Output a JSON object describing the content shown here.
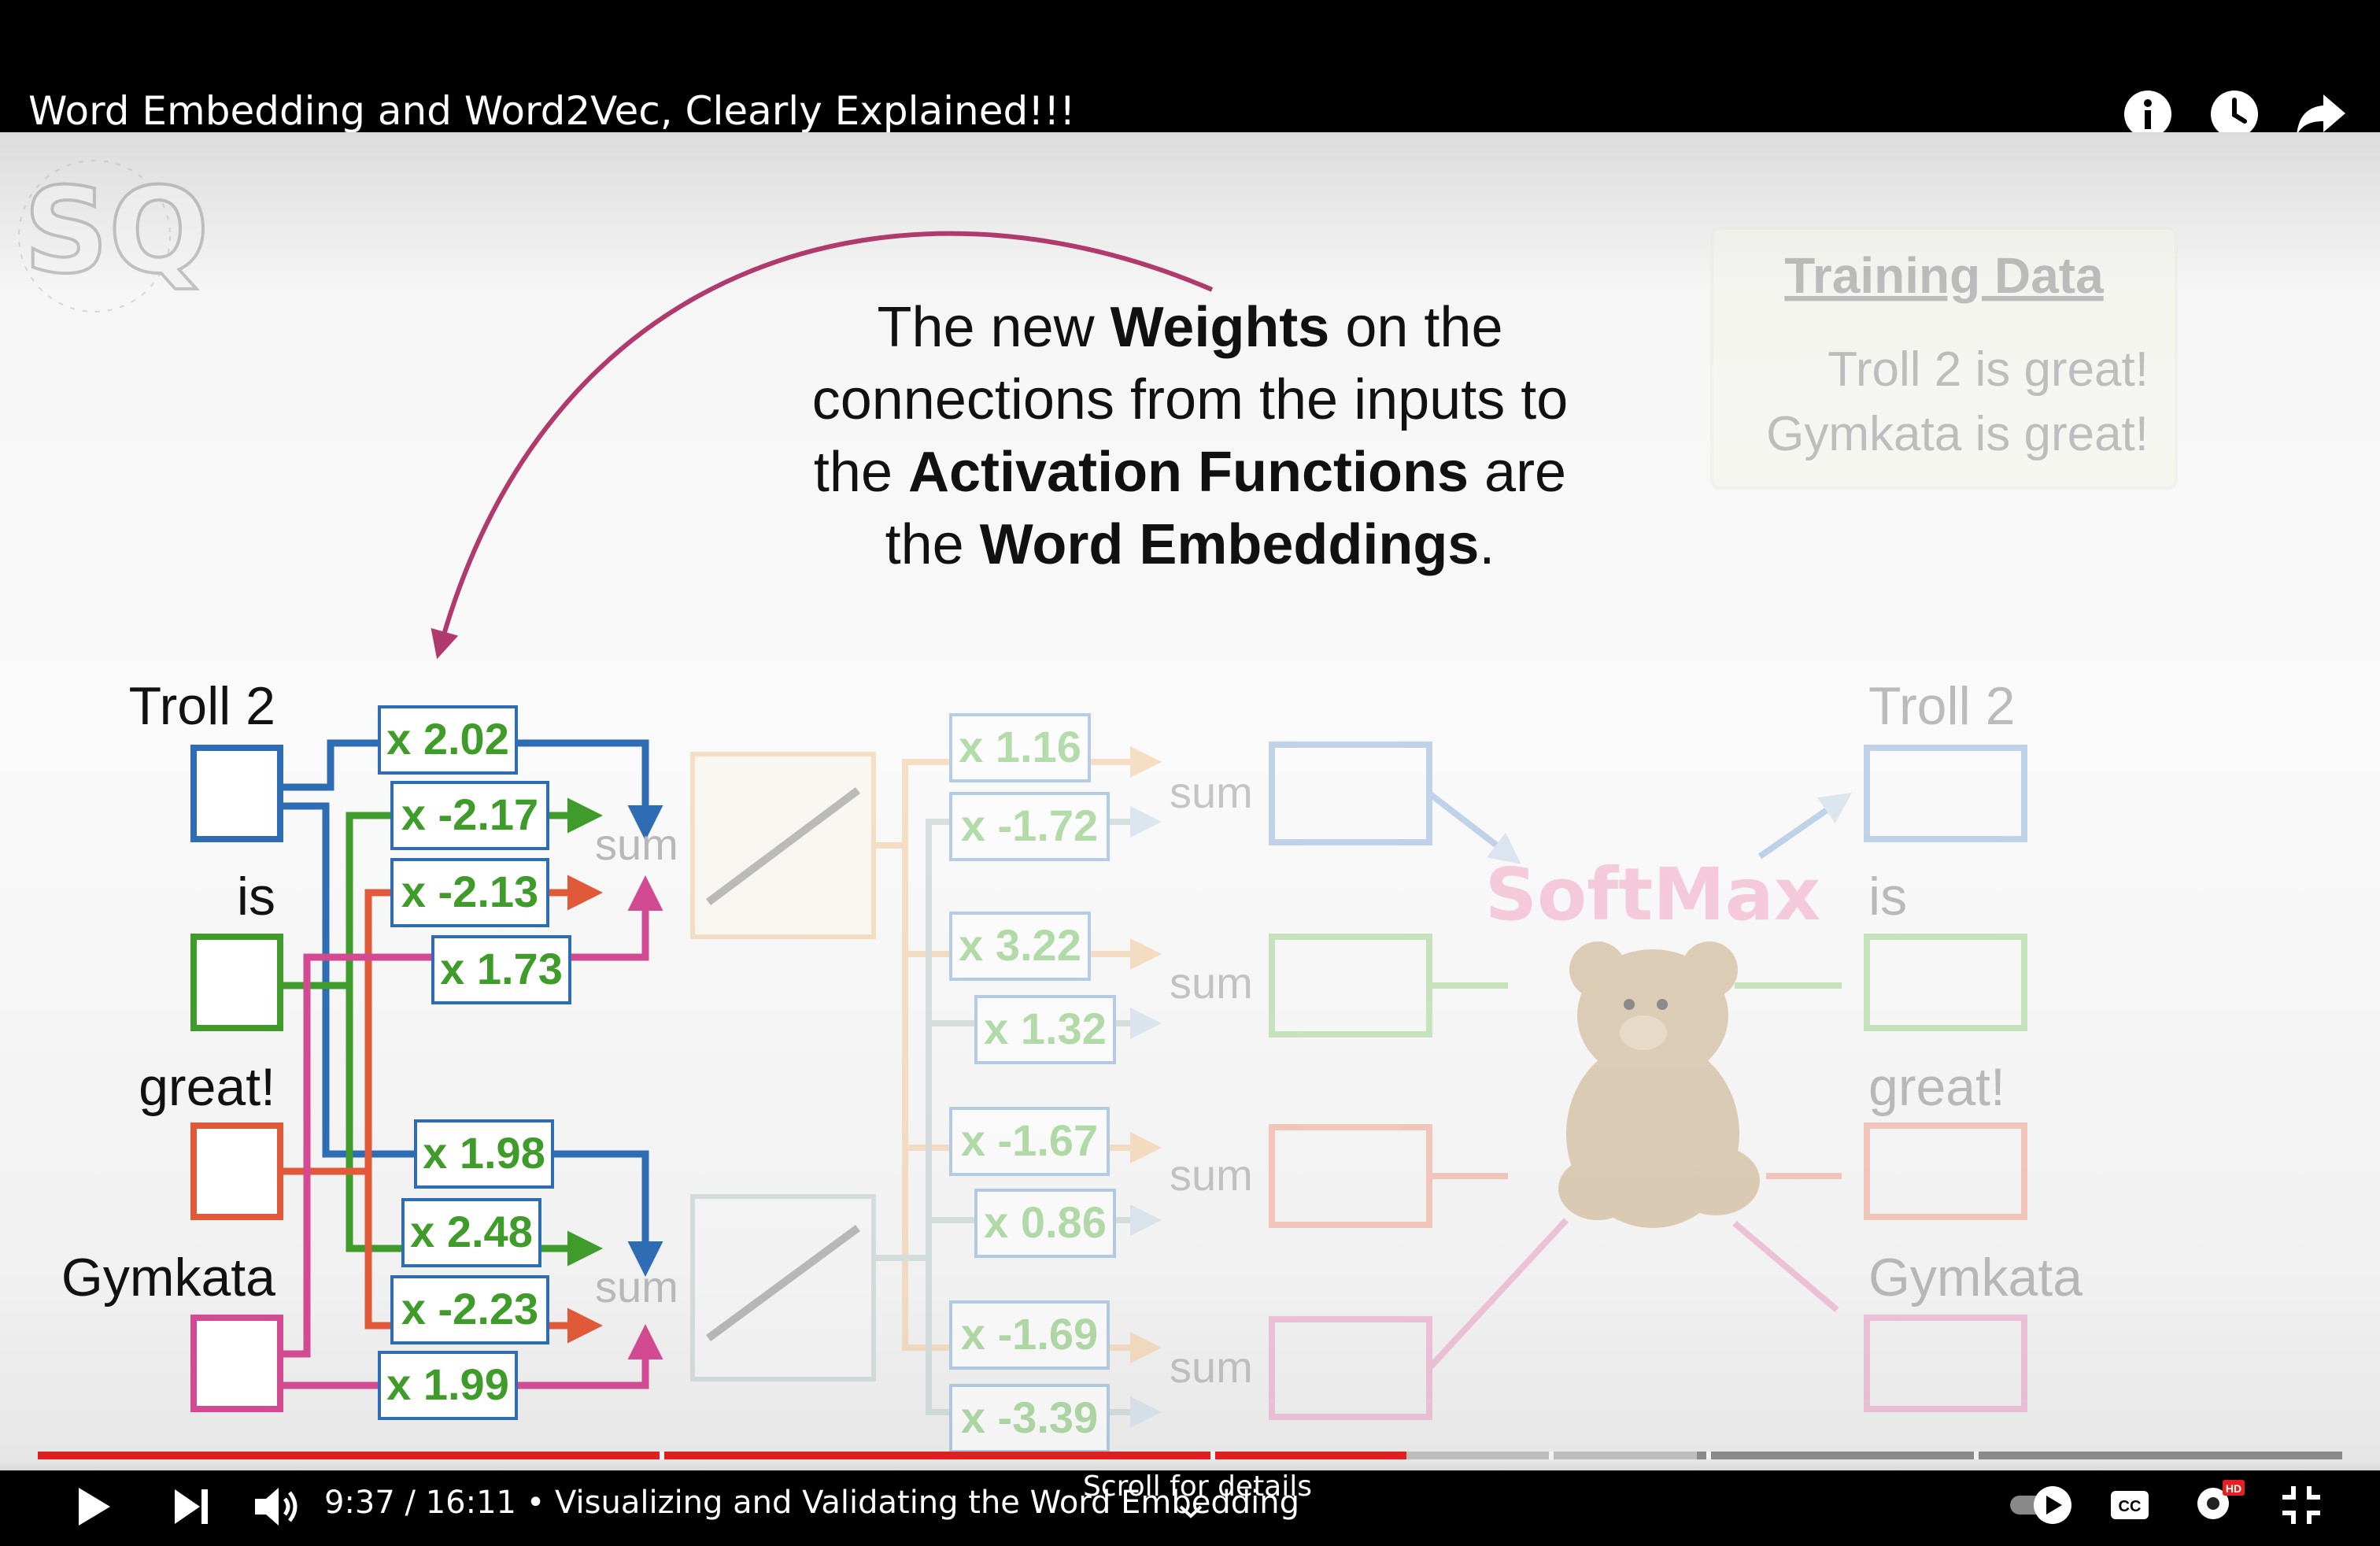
{
  "video": {
    "title": "Word Embedding and Word2Vec, Clearly Explained!!!",
    "top_icons": [
      "info-icon",
      "watch-later-icon",
      "share-icon"
    ]
  },
  "slide": {
    "logo_letters": "SQ",
    "callout": {
      "lines": [
        [
          {
            "t": "The new ",
            "b": false
          },
          {
            "t": "Weights",
            "b": true
          },
          {
            "t": " on the",
            "b": false
          }
        ],
        [
          {
            "t": "connections from the inputs to",
            "b": false
          }
        ],
        [
          {
            "t": "the ",
            "b": false
          },
          {
            "t": "Activation Functions",
            "b": true
          },
          {
            "t": " are",
            "b": false
          }
        ],
        [
          {
            "t": "the ",
            "b": false
          },
          {
            "t": "Word Embeddings",
            "b": true
          },
          {
            "t": ".",
            "b": false
          }
        ]
      ]
    },
    "training_data": {
      "title": "Training Data",
      "lines": [
        "Troll 2 is great!",
        "Gymkata is great!"
      ]
    },
    "input_words": [
      "Troll 2",
      "is",
      "great!",
      "Gymkata"
    ],
    "output_words": [
      "Troll 2",
      "is",
      "great!",
      "Gymkata"
    ],
    "embedding_weights_top": [
      "x 2.02",
      "x -2.17",
      "x -2.13",
      "x 1.73"
    ],
    "embedding_weights_bottom": [
      "x 1.98",
      "x 2.48",
      "x -2.23",
      "x 1.99"
    ],
    "output_weights": [
      "x 1.16",
      "x -1.72",
      "x 3.22",
      "x 1.32",
      "x -1.67",
      "x 0.86",
      "x -1.69",
      "x -3.39"
    ],
    "sum_label": "sum",
    "softmax_label": "SoftMax",
    "colors": {
      "troll2": "#2e6db4",
      "is": "#3f9c2a",
      "great": "#e05a3a",
      "gymkata": "#d24b92",
      "arrow_callout": "#b03a6e"
    }
  },
  "player": {
    "current_time": "9:37",
    "duration": "16:11",
    "chapter": "• Visualizing and Validating the Word Embedding",
    "scroll_hint": "Scroll for details",
    "progress_fraction": 0.594,
    "colors": {
      "played": "#e02020",
      "buffered": "#bdbdbd",
      "unplayed": "#8a8a8a"
    }
  }
}
